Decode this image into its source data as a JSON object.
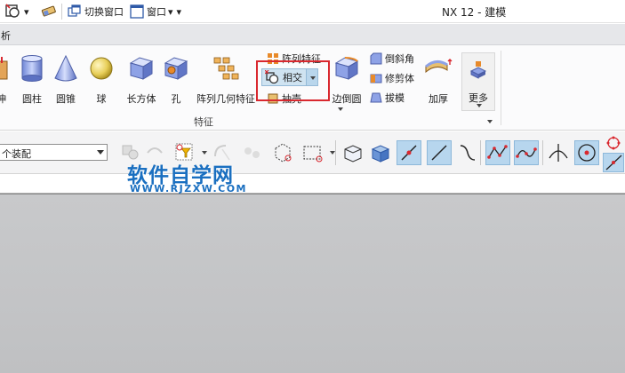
{
  "window": {
    "title": "NX 12 - 建模"
  },
  "quick_access": {
    "switch_window_label": "切换窗口",
    "window_label": "窗口"
  },
  "tabs": {
    "partial_label": "析"
  },
  "ribbon": {
    "buttons": {
      "partial_left": "伸",
      "cylinder": "圆柱",
      "cone": "圆锥",
      "sphere": "球",
      "block": "长方体",
      "hole": "孔",
      "pattern_geometry": "阵列几何特征",
      "edge_blend": "边倒圆",
      "thicken": "加厚",
      "more": "更多"
    },
    "small_items": {
      "pattern_feature": "阵列特征",
      "intersect": "相交",
      "shell": "抽壳",
      "chamfer": "倒斜角",
      "trim_body": "修剪体",
      "draft": "拔模"
    },
    "group_label": "特征"
  },
  "selection_bar": {
    "filter_value": "个装配"
  },
  "watermark": {
    "title": "软件自学网",
    "url": "WWW.RJZXW.COM"
  },
  "colors": {
    "accent": "#1a6fc0",
    "highlight": "#d9282f",
    "selected_button": "#cfe3f1"
  }
}
